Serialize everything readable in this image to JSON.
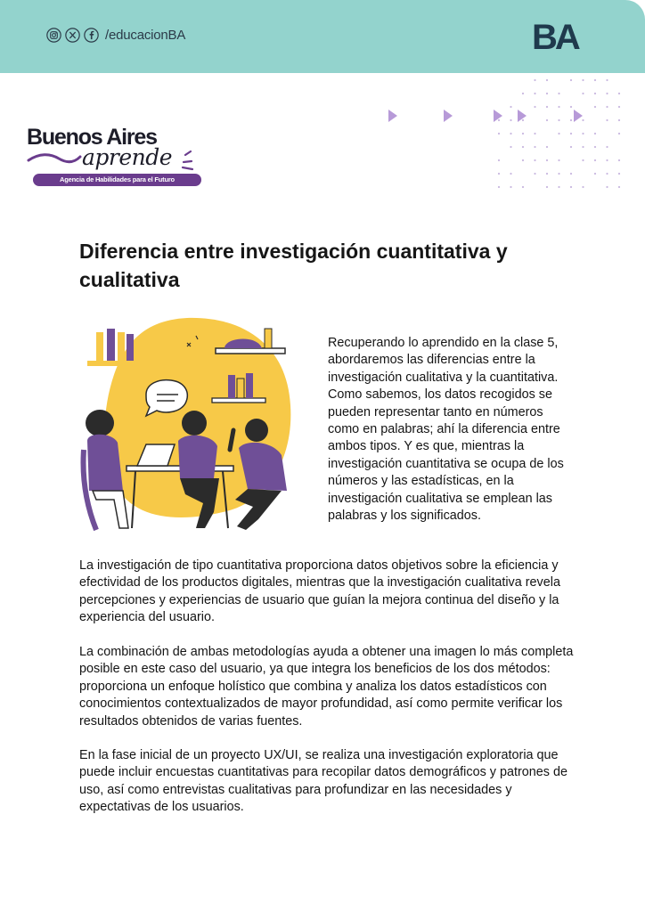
{
  "header": {
    "social_icons": [
      "instagram-icon",
      "x-icon",
      "facebook-icon"
    ],
    "handle": "/educacionBA",
    "logo_text": "BA",
    "background_color": "#93d3cd"
  },
  "brand": {
    "name": "Buenos Aires",
    "script": "aprende",
    "tagline": "Agencia de Habilidades para el Futuro",
    "accent_color": "#6a3c8d"
  },
  "document": {
    "title": "Diferencia entre investigación cuantitativa y cualitativa",
    "intro": "Recuperando lo aprendido en la clase 5, abordaremos las diferencias entre la investigación cualitativa y la cuantitativa. Como sabemos, los datos recogidos se pueden representar tanto en números como en palabras; ahí la diferencia entre ambos tipos. Y es que, mientras la investigación cuantitativa se ocupa de los números y las estadísticas, en la investigación cualitativa se emplean las palabras y los significados.",
    "paragraphs": [
      "La investigación de tipo cuantitativa proporciona datos objetivos sobre la eficiencia y efectividad de los productos digitales, mientras que la investigación cualitativa revela percepciones y experiencias de usuario que guían la mejora continua del diseño y la experiencia del usuario.",
      "La combinación de ambas metodologías ayuda a obtener una imagen lo más completa posible en este caso del usuario, ya que integra los beneficios de los dos métodos: proporciona un enfoque holístico que combina y analiza los datos estadísticos con conocimientos contextualizados de mayor profundidad, así como permite verificar los resultados obtenidos de varias fuentes.",
      "En la fase inicial de un proyecto UX/UI, se realiza una investigación exploratoria que puede incluir encuestas cuantitativas para recopilar datos demográficos y patrones de uso, así como entrevistas cualitativas para profundizar en las necesidades y expectativas de los usuarios."
    ]
  },
  "decor": {
    "arrow_color": "#b79ad8",
    "dot_color": "#c9b8e0",
    "illustration_colors": [
      "#f7c948",
      "#6f4f97",
      "#2b2b2b"
    ]
  }
}
